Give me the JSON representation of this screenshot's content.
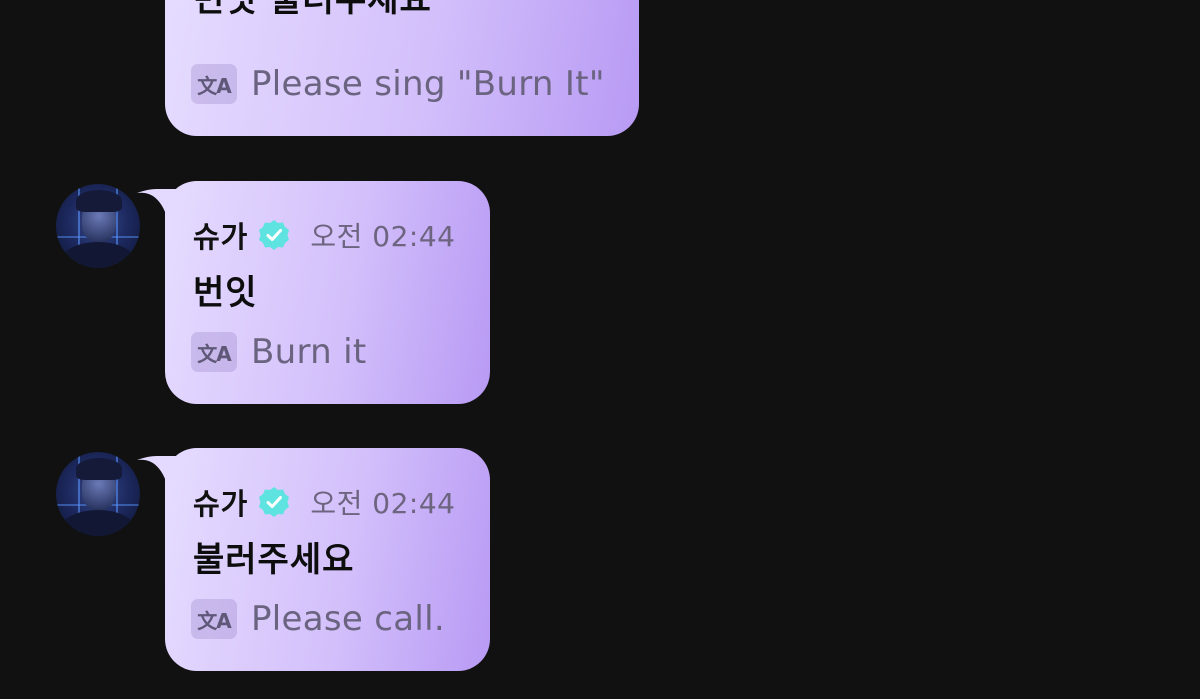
{
  "colors": {
    "background": "#111111",
    "bubble_start": "#e6dcff",
    "bubble_end": "#b89af4",
    "verified": "#5fe3e0"
  },
  "messages": [
    {
      "text": "번잇 불러주세요",
      "translation": "Please sing \"Burn It\""
    },
    {
      "sender": "슈가",
      "time": "오전 02:44",
      "text": "번잇",
      "translation": "Burn it"
    },
    {
      "sender": "슈가",
      "time": "오전 02:44",
      "text": "불러주세요",
      "translation": "Please call."
    }
  ],
  "icons": {
    "translate": "translate-icon",
    "verified": "verified-badge-icon"
  }
}
